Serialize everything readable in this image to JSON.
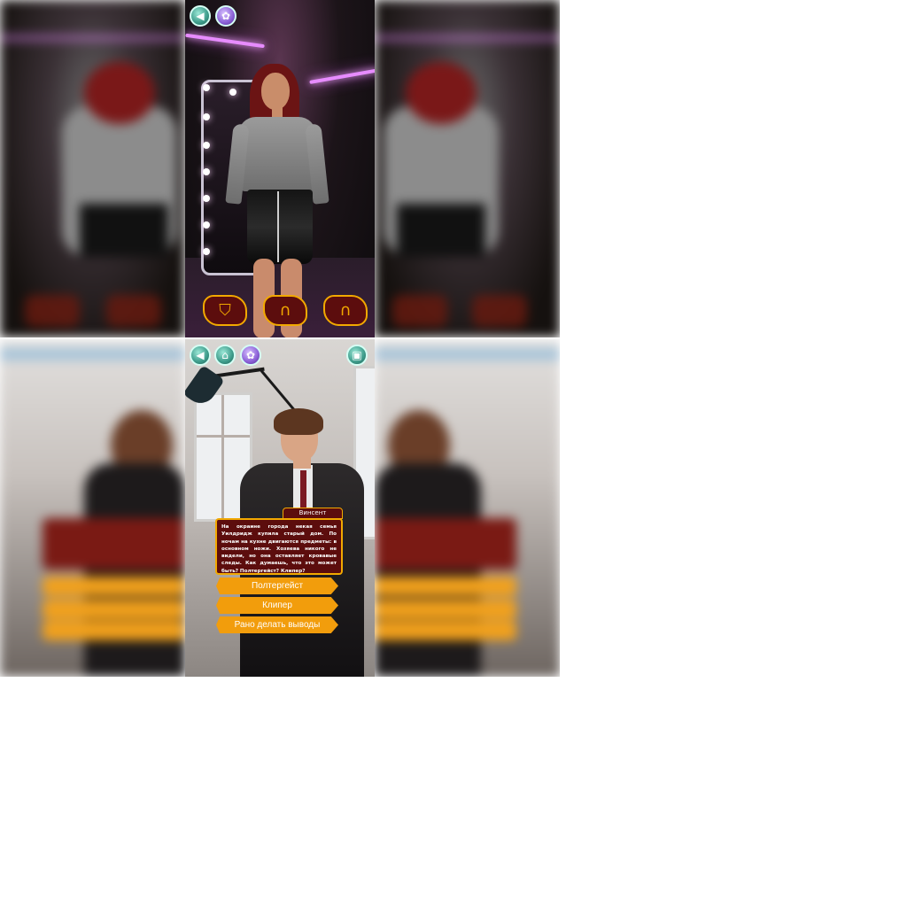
{
  "top_screen": {
    "nav": {
      "back_icon": "back-arrow-icon",
      "settings_icon": "gear-flower-icon"
    },
    "wardrobe_buttons": [
      {
        "icon": "dress-form-icon",
        "glyph": "⛉"
      },
      {
        "icon": "hairstyle-icon",
        "glyph": "∩"
      },
      {
        "icon": "head-profile-icon",
        "glyph": "∩"
      }
    ],
    "colors": {
      "neon": "#e78cff",
      "button_fill": "#5c0d0d",
      "button_border": "#f2a900"
    }
  },
  "bottom_screen": {
    "nav": {
      "back_icon": "back-arrow-icon",
      "hanger_icon": "hanger-icon",
      "settings_icon": "gear-flower-icon",
      "save_icon": "save-disk-icon"
    },
    "dialog": {
      "speaker": "Винсент",
      "text": "На окраине города некая семья Уилдридж купила старый дом. По ночам на кухне двигаются предметы: в основном ножи. Хозяева никого не видели, но она оставляет кровавые следы. Как думаешь, что это может быть? Полтергейст? Клипер?"
    },
    "choices": [
      {
        "label": "Полтергейст"
      },
      {
        "label": "Клипер"
      },
      {
        "label": "Рано делать выводы"
      }
    ],
    "colors": {
      "choice_fill": "#f29d0c",
      "dialog_fill": "#5c0d0d",
      "dialog_border": "#f2a900"
    }
  }
}
